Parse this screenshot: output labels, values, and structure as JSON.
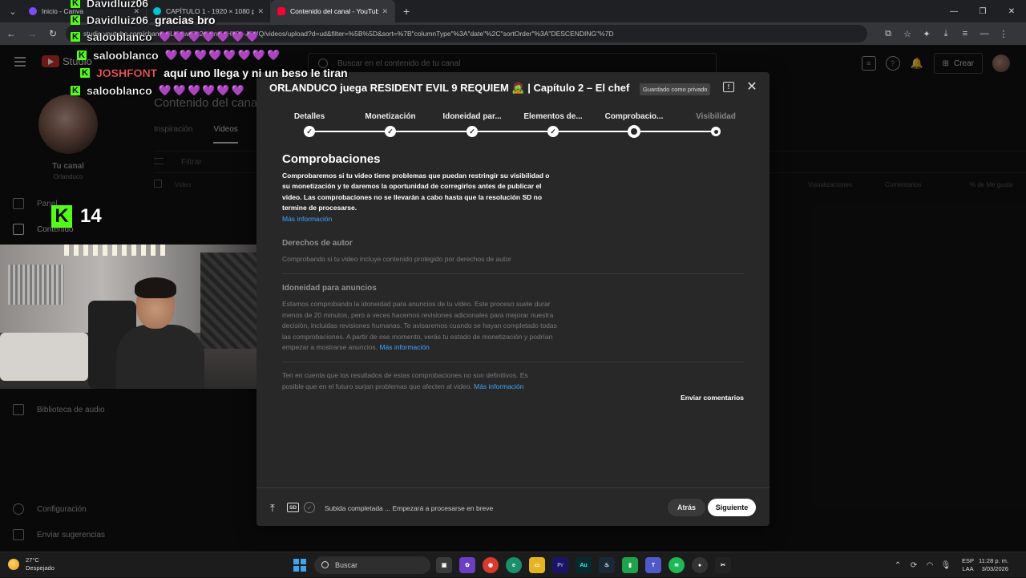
{
  "browser": {
    "tabs": [
      {
        "title": "Inicio - Canva",
        "favicon_color": "#7b4cff"
      },
      {
        "title": "CAPÍTULO 1 - 1920 × 1080 px",
        "favicon_color": "#00c4cc"
      },
      {
        "title": "Contenido del canal - YouTube",
        "favicon_color": "#ff0033",
        "active": true
      }
    ],
    "new_tab": "+",
    "url": "studio.youtube.com/channel/UC1wvffo2qKmt5nHL21-JDUQ/videos/upload?d=ud&filter=%5B%5D&sort=%7B\"columnType\"%3A\"date\"%2C\"sortOrder\"%3A\"DESCENDING\"%7D"
  },
  "studio": {
    "logo_text": "Studio",
    "search_placeholder": "Buscar en el contenido de tu canal",
    "create_label": "Crear",
    "channel_label": "Tu canal",
    "channel_name": "Orlanduco",
    "sidebar": {
      "panel": "Panel",
      "content": "Contenido",
      "audio_library": "Biblioteca de audio",
      "settings": "Configuración",
      "feedback": "Enviar sugerencias"
    },
    "page_title": "Contenido del canal",
    "tabs": [
      "Inspiración",
      "Videos"
    ],
    "filter_placeholder": "Filtrar",
    "columns": {
      "video": "Video",
      "views": "Visualizaciones",
      "comments": "Comentarios",
      "likes": "% de Me gusta"
    }
  },
  "modal": {
    "title": "ORLANDUCO juega RESIDENT EVIL 9 REQUIEM 🧟 | Capítulo 2 – El chef \"...",
    "saved_badge": "Guardado como privado",
    "steps": [
      "Detalles",
      "Monetización",
      "Idoneidad par...",
      "Elementos de...",
      "Comprobacio...",
      "Visibilidad"
    ],
    "current_step": 5,
    "checks_title": "Comprobaciones",
    "checks_text": "Comprobaremos si tu video tiene problemas que puedan restringir su visibilidad o su monetización y te daremos la oportunidad de corregirlos antes de publicar el video. Las comprobaciones no se llevarán a cabo hasta que la resolución SD no termine de procesarse.",
    "more_info": "Más información",
    "copyright_title": "Derechos de autor",
    "copyright_text": "Comprobando si tu video incluye contenido protegido por derechos de autor",
    "ads_title": "Idoneidad para anuncios",
    "ads_text": "Estamos comprobando la idoneidad para anuncios de tu video. Este proceso suele durar menos de 20 minutos, pero a veces hacemos revisiones adicionales para mejorar nuestra decisión, incluidas revisiones humanas. Te avisaremos cuando se hayan completado todas las comprobaciones. A partir de ese momento, verás tu estado de monetización y podrían empezar a mostrarse anuncios.",
    "note_text": "Ten en cuenta que los resultados de estas comprobaciones no son definitivos. Es posible que en el futuro surjan problemas que afecten al video.",
    "send_feedback": "Enviar comentarios",
    "footer": {
      "sd_badge": "SD",
      "status": "Subida completada ... Empezará a procesarse en breve",
      "back": "Atrás",
      "next": "Siguiente"
    }
  },
  "overlay": {
    "chat": [
      {
        "user": "Davidluiz06",
        "msg": "",
        "hearts": ""
      },
      {
        "user": "Davidluiz06",
        "msg": "gracias bro",
        "hearts": ""
      },
      {
        "user": "salooblanco",
        "msg": "",
        "hearts": "💜💜💜💜💜💜💜"
      },
      {
        "user": "salooblanco",
        "msg": "",
        "hearts": "💜💜💜💜💜💜💜💜"
      },
      {
        "user": "JOSHFONT",
        "msg": "aquí uno llega y ni un beso le tiran",
        "hearts": ""
      },
      {
        "user": "salooblanco",
        "msg": "",
        "hearts": "💜💜💜💜💜💜"
      }
    ],
    "chat_badge": "K",
    "viewer_count": "14"
  },
  "taskbar": {
    "temp": "27°C",
    "weather": "Despejado",
    "search": "Buscar",
    "lang_top": "ESP",
    "lang_bottom": "LAA",
    "time": "11:28 p. m.",
    "date": "3/03/2026"
  }
}
